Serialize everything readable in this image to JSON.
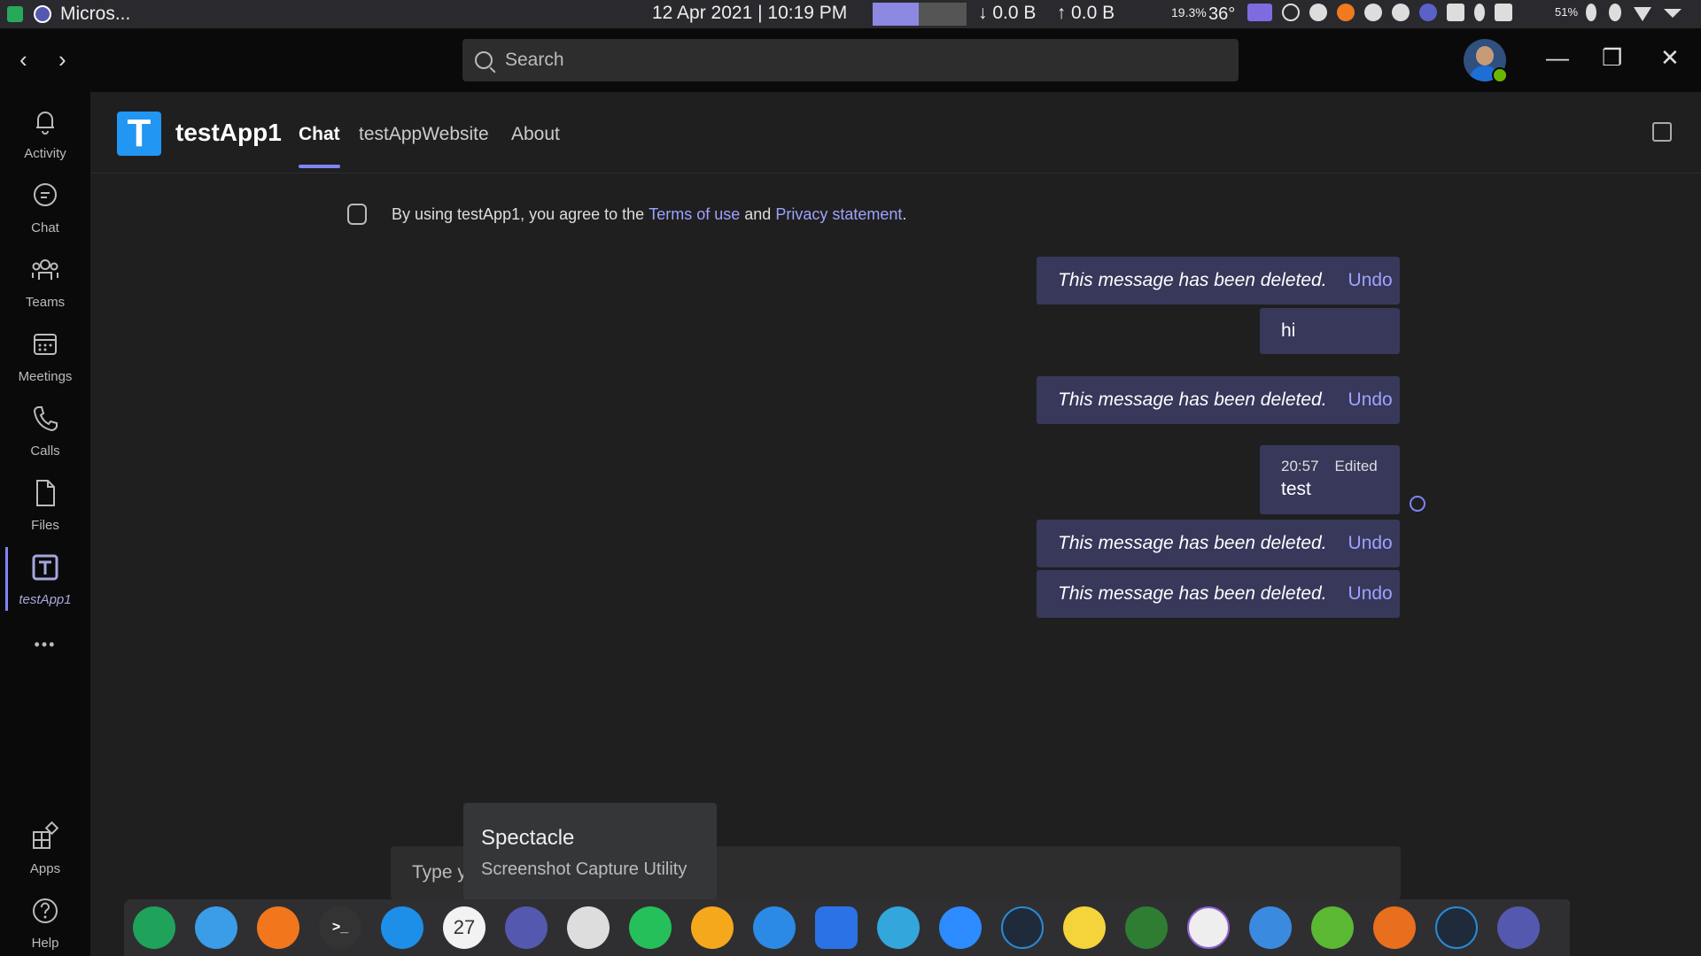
{
  "os_bar": {
    "app_title": "Micros...",
    "datetime": "12 Apr 2021 | 10:19 PM",
    "net_down": "↓   0.0 B",
    "net_up": "↑   0.0 B",
    "cpu": "19.3%",
    "temp": "36°",
    "battery": "51%"
  },
  "titlebar": {
    "back": "‹",
    "forward": "›",
    "search_placeholder": "Search",
    "minimize": "—",
    "restore": "❐",
    "close": "✕"
  },
  "rail": {
    "items": [
      {
        "label": "Activity",
        "icon": "bell-icon"
      },
      {
        "label": "Chat",
        "icon": "chat-icon"
      },
      {
        "label": "Teams",
        "icon": "teams-icon"
      },
      {
        "label": "Meetings",
        "icon": "calendar-icon"
      },
      {
        "label": "Calls",
        "icon": "phone-icon"
      },
      {
        "label": "Files",
        "icon": "file-icon"
      },
      {
        "label": "testApp1",
        "icon": "testapp-icon"
      }
    ],
    "more": "•••",
    "apps_label": "Apps",
    "help_label": "Help"
  },
  "app": {
    "logo_letter": "T",
    "name": "testApp1",
    "tabs": [
      "Chat",
      "testAppWebsite",
      "About"
    ],
    "active_tab": "Chat"
  },
  "chat": {
    "terms_prefix": "By using testApp1, you agree to the",
    "terms_link": "Terms of use",
    "terms_and": "and",
    "privacy_link": "Privacy statement",
    "terms_suffix": ".",
    "deleted_text": "This message has been deleted.",
    "undo_label": "Undo",
    "msg_hi": "hi",
    "msg_test_time": "20:57",
    "msg_test_edited": "Edited",
    "msg_test": "test",
    "compose_placeholder": "Type y"
  },
  "tooltip": {
    "title": "Spectacle",
    "subtitle": "Screenshot Capture Utility"
  },
  "dock": {
    "calendar_day": "27"
  },
  "colors": {
    "accent": "#7f85f5",
    "link": "#9ea2ff",
    "bubble": "#37385a",
    "background": "#1f1f1f"
  }
}
